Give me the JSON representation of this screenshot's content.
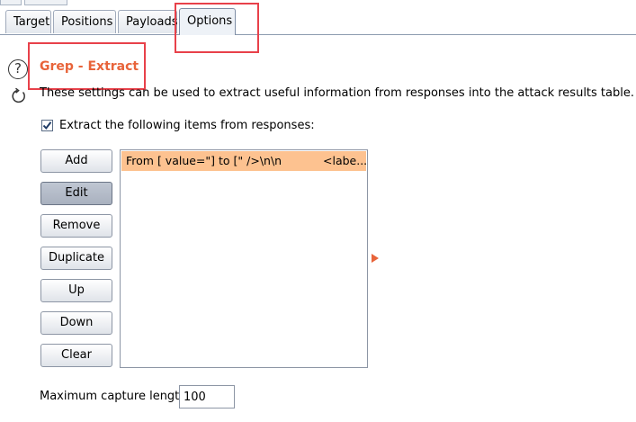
{
  "tabs": [
    {
      "label": "Target",
      "active": false
    },
    {
      "label": "Positions",
      "active": false
    },
    {
      "label": "Payloads",
      "active": false
    },
    {
      "label": "Options",
      "active": true
    }
  ],
  "section": {
    "title": "Grep - Extract",
    "description": "These settings can be used to extract useful information from responses into the attack results table.",
    "checkbox_label": "Extract the following items from responses:",
    "checkbox_checked": true
  },
  "buttons": {
    "add": "Add",
    "edit": "Edit",
    "remove": "Remove",
    "duplicate": "Duplicate",
    "up": "Up",
    "down": "Down",
    "clear": "Clear"
  },
  "extract_list": [
    {
      "from_to": "From [ value=\"] to [\" />\\n\\n",
      "extra": "<labe..."
    }
  ],
  "max_capture": {
    "label": "Maximum capture length:",
    "value": "100"
  },
  "colors": {
    "accent": "#e8643a",
    "selected_row": "#fdc290",
    "highlight_box": "#e8414a"
  },
  "icons": [
    "help-icon",
    "refresh-icon",
    "checkmark-icon",
    "expand-arrow-icon"
  ]
}
